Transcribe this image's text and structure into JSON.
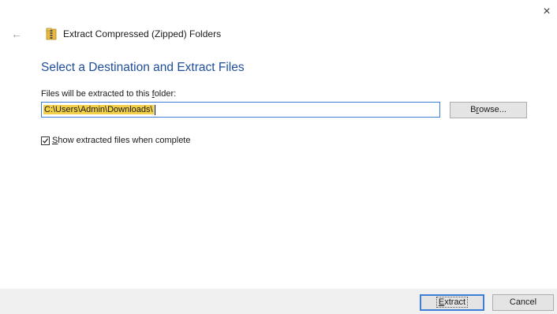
{
  "window": {
    "title": "Extract Compressed (Zipped) Folders",
    "close_glyph": "×",
    "back_glyph": "←",
    "icons": {
      "back": "back-arrow-icon",
      "zip": "zipped-folder-icon",
      "close": "close-icon"
    }
  },
  "main": {
    "heading": "Select a Destination and Extract Files",
    "folder_label_prefix": "Files will be extracted to this ",
    "folder_label_accel": "f",
    "folder_label_suffix": "older:",
    "path_value": "C:\\Users\\Admin\\Downloads\\",
    "browse_accel_prefix": "B",
    "browse_accel": "r",
    "browse_accel_suffix": "owse...",
    "checkbox": {
      "checked": true,
      "accel_prefix": "",
      "accel": "S",
      "label_suffix": "how extracted files when complete"
    }
  },
  "footer": {
    "extract_accel": "E",
    "extract_suffix": "xtract",
    "cancel_label": "Cancel"
  },
  "colors": {
    "heading": "#1f4e9a",
    "focus_border": "#3f7ed6",
    "selection": "#f2d04a",
    "footer_bg": "#f0f0f0",
    "button_bg": "#e4e4e4"
  }
}
